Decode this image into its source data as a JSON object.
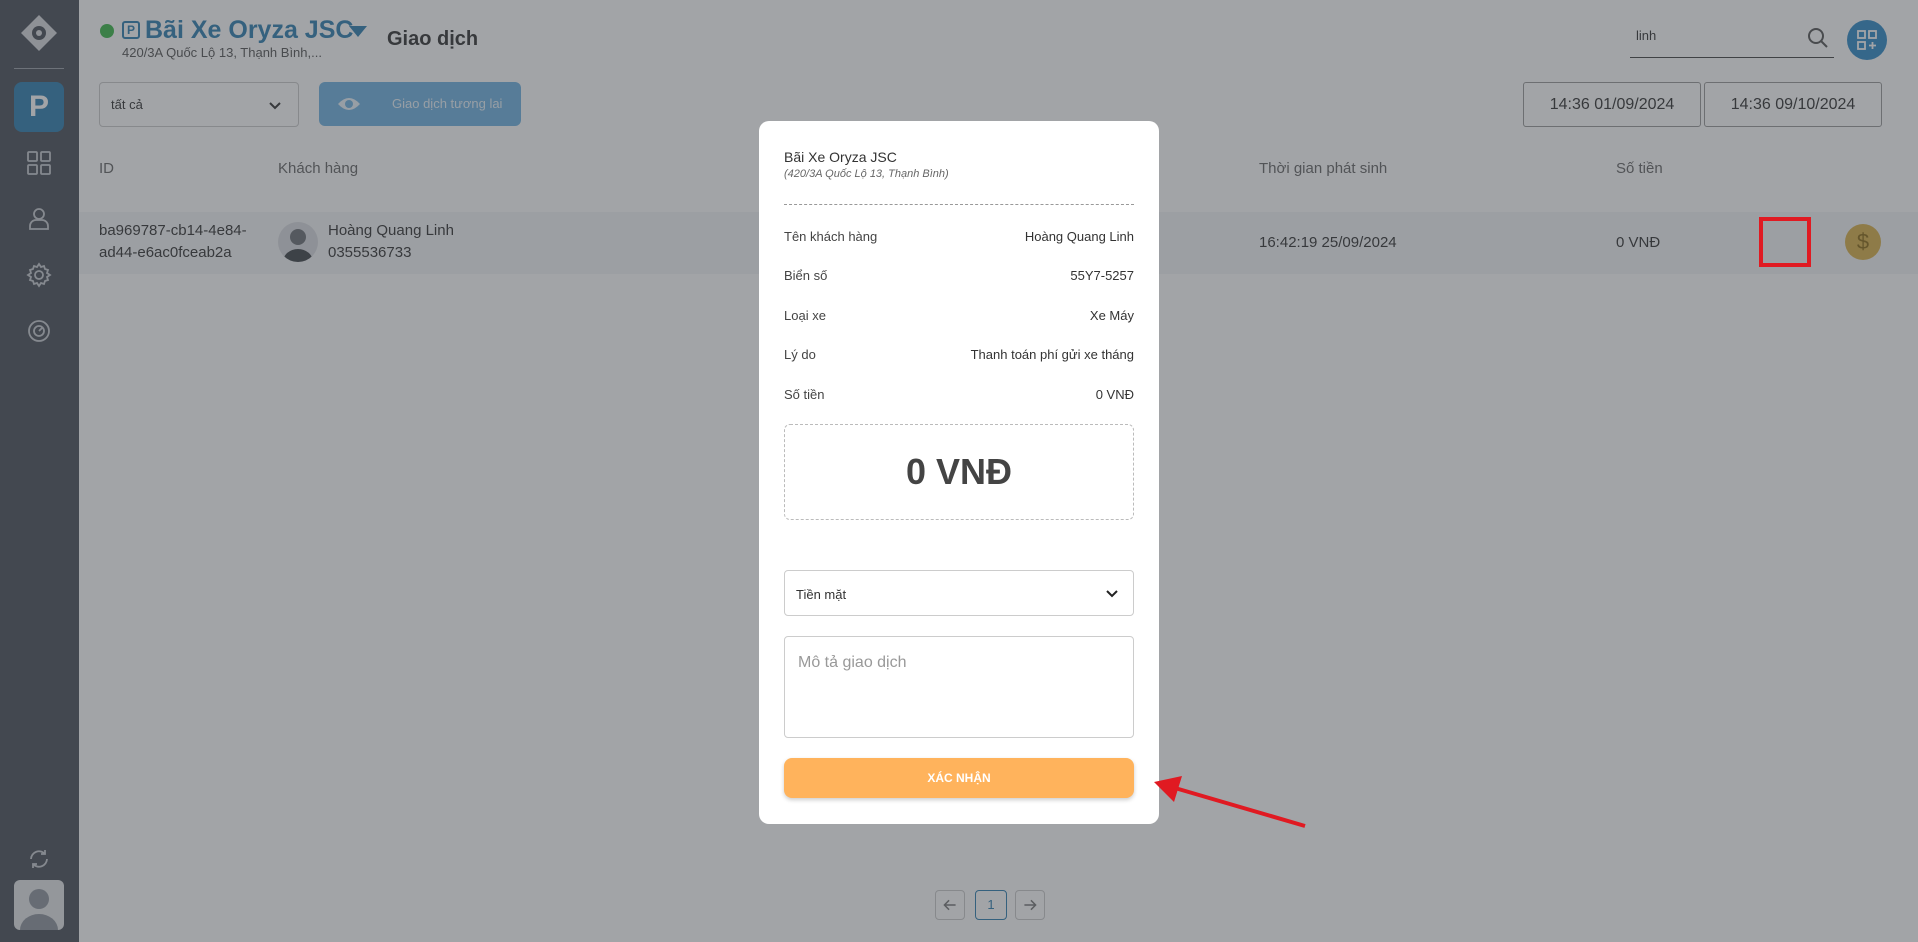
{
  "header": {
    "lot_name": "Bãi Xe Oryza JSC",
    "lot_address": "420/3A Quốc Lộ 13, Thạnh Bình,...",
    "page_title": "Giao dịch",
    "park_badge": "P"
  },
  "sidebar": {
    "logo": "logo-icon",
    "active_label": "P",
    "items": [
      "dashboard-grid-icon",
      "user-icon",
      "settings-gear-icon",
      "history-icon"
    ],
    "bottom_items": [
      "sync-icon",
      "user-avatar"
    ]
  },
  "search": {
    "value": "linh"
  },
  "filters": {
    "status_selected": "tất cả",
    "future_button_label": "Giao dịch tương lai",
    "date_from": "14:36 01/09/2024",
    "date_to": "14:36 09/10/2024"
  },
  "table": {
    "columns": {
      "id": "ID",
      "customer": "Khách hàng",
      "time": "Thời gian phát sinh",
      "amount": "Số tiền"
    },
    "rows": [
      {
        "id_line1": "ba969787-cb14-4e84-",
        "id_line2": "ad44-e6ac0fceab2a",
        "customer_name": "Hoàng Quang Linh",
        "customer_phone": "0355536733",
        "time": "16:42:19 25/09/2024",
        "amount": "0 VNĐ",
        "action_icon": "$"
      }
    ]
  },
  "pagination": {
    "current": "1"
  },
  "modal": {
    "lot_name": "Bãi Xe Oryza JSC",
    "lot_address": "(420/3A Quốc Lộ 13, Thạnh Bình)",
    "fields": [
      {
        "label": "Tên khách hàng",
        "value": "Hoàng Quang Linh"
      },
      {
        "label": "Biển số",
        "value": "55Y7-5257"
      },
      {
        "label": "Loại xe",
        "value": "Xe Máy"
      },
      {
        "label": "Lý do",
        "value": "Thanh toán phí gửi xe tháng"
      },
      {
        "label": "Số tiền",
        "value": "0 VNĐ"
      }
    ],
    "amount_display": "0 VNĐ",
    "payment_method": "Tiền mặt",
    "description_placeholder": "Mô tả giao dịch",
    "confirm_label": "XÁC NHẬN"
  },
  "colors": {
    "primary": "#2f7fb0",
    "confirm": "#ffb35c",
    "highlight": "#e01a22",
    "online": "#3cb84a"
  }
}
